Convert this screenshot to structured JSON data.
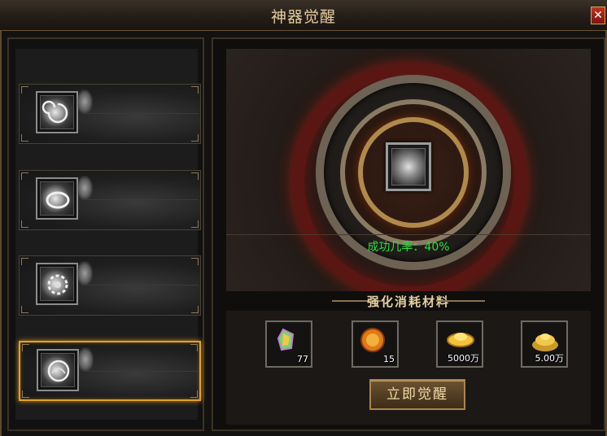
{
  "window": {
    "title": "神器觉醒",
    "close_label": "✕"
  },
  "artifact_list": {
    "items": [
      {
        "icon": "silver-spiral-artifact-icon",
        "selected": false
      },
      {
        "icon": "silver-bell-artifact-icon",
        "selected": false
      },
      {
        "icon": "silver-gear-artifact-icon",
        "selected": false
      },
      {
        "icon": "silver-orb-artifact-icon",
        "selected": true
      }
    ]
  },
  "awaken": {
    "success_text": "成功几率：40%",
    "materials_title": "强化消耗材料",
    "materials": [
      {
        "icon": "rainbow-crystal-icon",
        "count": "77"
      },
      {
        "icon": "golden-orb-icon",
        "count": "15"
      },
      {
        "icon": "gold-ingot-icon",
        "count": "5000万"
      },
      {
        "icon": "gold-coin-pile-icon",
        "count": "5.00万"
      }
    ],
    "button_label": "立即觉醒"
  },
  "colors": {
    "accent": "#e0a22b",
    "success": "#28e23a",
    "gold_text": "#e6cfa0"
  }
}
